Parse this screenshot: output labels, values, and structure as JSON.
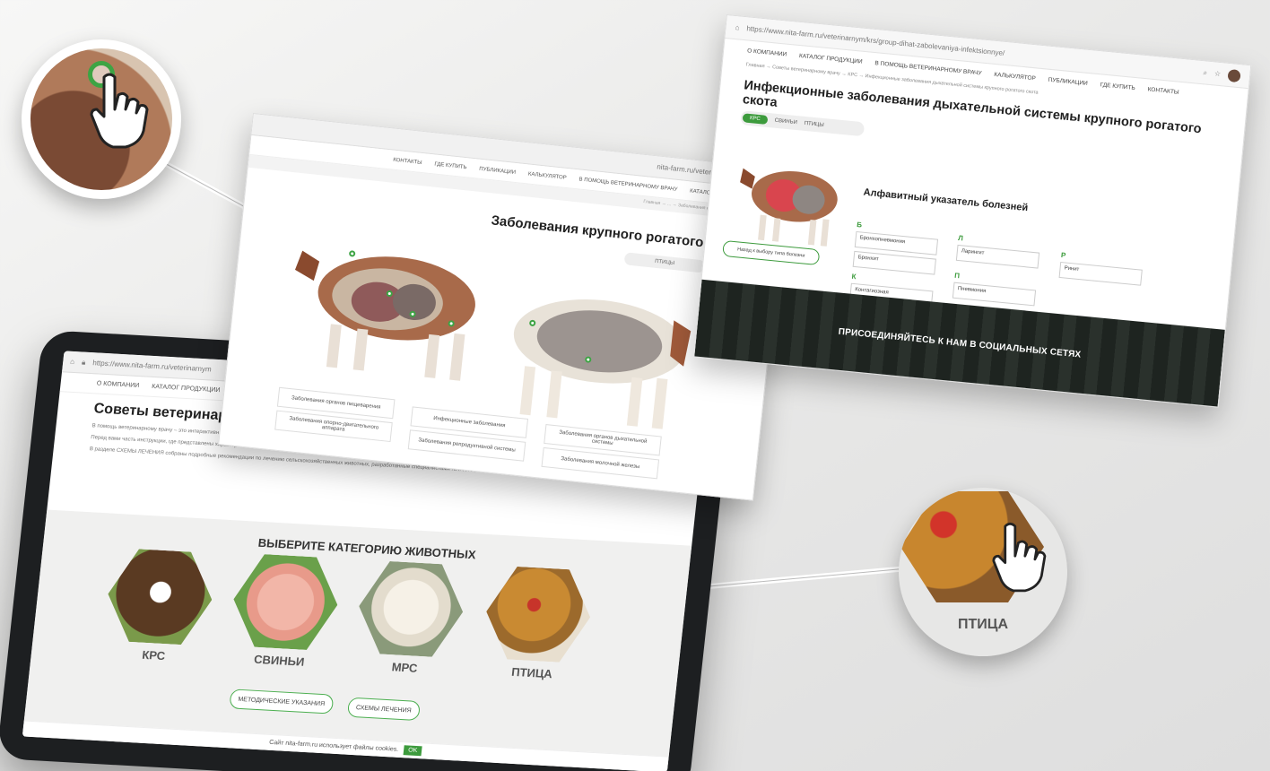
{
  "tablet": {
    "url": "https://www.nita-farm.ru/veterinarnym",
    "nav": [
      "О КОМПАНИИ",
      "КАТАЛОГ ПРОДУКЦИИ"
    ],
    "title": "Советы ветеринарно",
    "paragraphs": [
      "В помощь ветеринарному врачу – это интерактивный раздел для обсуждения...",
      "Перед вами часть инструкции, где представлены характерные клинические признаки и дифференциальные указатели...",
      "В разделе СХЕМЫ ЛЕЧЕНИЯ собраны подробные рекомендации по лечению сельскохозяйственных животных, разработанные специалистами NITA-FARM..."
    ],
    "category_title": "ВЫБЕРИТЕ КАТЕГОРИЮ ЖИВОТНЫХ",
    "categories": [
      "КРС",
      "СВИНЬИ",
      "МРС",
      "ПТИЦА"
    ],
    "buttons": {
      "method": "МЕТОДИЧЕСКИЕ УКАЗАНИЯ",
      "schemes": "СХЕМЫ ЛЕЧЕНИЯ"
    },
    "cookie_text": "Сайт nita-farm.ru использует файлы cookies.",
    "cookie_ok": "OK"
  },
  "middle": {
    "url": "nita-farm.ru/veterinarnym/krs/",
    "nav": [
      "КОНТАКТЫ",
      "ГДЕ КУПИТЬ",
      "ПУБЛИКАЦИИ",
      "КАЛЬКУЛЯТОР",
      "В ПОМОЩЬ ВЕТЕРИНАРНОМУ ВРАЧУ",
      "КАТАЛОГ ПРОДУКЦИИ"
    ],
    "crumb": "Главная → ... → Заболевания крупного рогатого скота",
    "title": "Заболевания крупного рогатого скота",
    "tab": "ПТИЦЫ",
    "cards": [
      "Заболевания органов пищеварения",
      "Заболевания опорно-двигательного аппарата",
      "Инфекционные заболевания",
      "Заболевания репродуктивной системы",
      "Заболевания органов дыхательной системы",
      "Заболевания молочной железы"
    ]
  },
  "right": {
    "url": "https://www.nita-farm.ru/veterinarnym/krs/group-dihat-zabolevaniya-infektsionnye/",
    "nav": [
      "О КОМПАНИИ",
      "КАТАЛОГ ПРОДУКЦИИ",
      "В ПОМОЩЬ ВЕТЕРИНАРНОМУ ВРАЧУ",
      "КАЛЬКУЛЯТОР",
      "ПУБЛИКАЦИИ",
      "ГДЕ КУПИТЬ",
      "КОНТАКТЫ"
    ],
    "crumb": "Главная → Советы ветеринарному врачу → КРС → Инфекционные заболевания дыхательной системы крупного рогатого скота",
    "title": "Инфекционные заболевания дыхательной системы крупного рогатого скота",
    "tabs": [
      "КРС",
      "СВИНЬИ",
      "ПТИЦЫ"
    ],
    "index_title": "Алфавитный указатель болезней",
    "letters": {
      "b": "Б",
      "l": "Л",
      "r": "Р",
      "k": "К",
      "p": "П"
    },
    "diseases": {
      "b1": "Бронхопневмония",
      "b2": "Бронхит",
      "l1": "Ларингит",
      "r1": "Ринит",
      "k1": "Контагиозная плевропневмония",
      "p1": "Пневмония"
    },
    "back_button": "Назад к выбору типа болезни",
    "social": "ПРИСОЕДИНЯЙТЕСЬ К НАМ В СОЦИАЛЬНЫХ СЕТЯХ"
  },
  "callout_right_label": "ПТИЦА",
  "colors": {
    "accent": "#3d9b3d",
    "dark": "#1d1f21"
  }
}
